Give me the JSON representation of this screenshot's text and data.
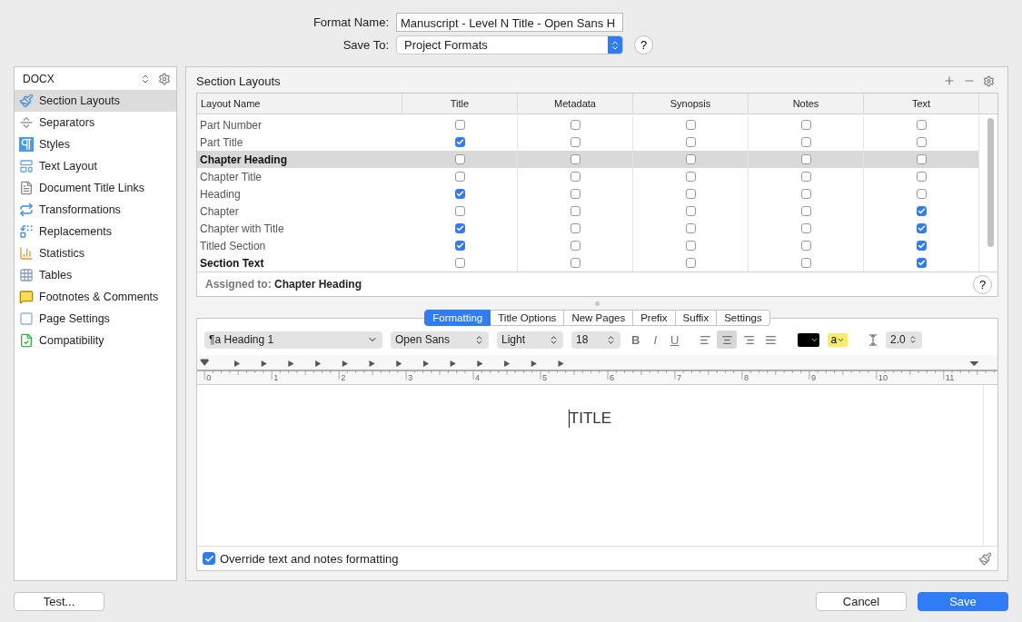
{
  "header": {
    "format_name_label": "Format Name:",
    "format_name_value": "Manuscript - Level N Title - Open Sans H",
    "save_to_label": "Save To:",
    "save_to_value": "Project Formats",
    "help": "?"
  },
  "sidebar": {
    "format": "DOCX",
    "items": [
      {
        "label": "Section Layouts",
        "selected": true
      },
      {
        "label": "Separators",
        "selected": false
      },
      {
        "label": "Styles",
        "selected": false
      },
      {
        "label": "Text Layout",
        "selected": false
      },
      {
        "label": "Document Title Links",
        "selected": false
      },
      {
        "label": "Transformations",
        "selected": false
      },
      {
        "label": "Replacements",
        "selected": false
      },
      {
        "label": "Statistics",
        "selected": false
      },
      {
        "label": "Tables",
        "selected": false
      },
      {
        "label": "Footnotes & Comments",
        "selected": false
      },
      {
        "label": "Page Settings",
        "selected": false
      },
      {
        "label": "Compatibility",
        "selected": false
      }
    ]
  },
  "section_layouts": {
    "title": "Section Layouts",
    "columns": [
      "Layout Name",
      "Title",
      "Metadata",
      "Synopsis",
      "Notes",
      "Text"
    ],
    "rows": [
      {
        "name": "Part Number",
        "bold": false,
        "selected": false,
        "checks": [
          false,
          false,
          false,
          false,
          false
        ]
      },
      {
        "name": "Part Title",
        "bold": false,
        "selected": false,
        "checks": [
          true,
          false,
          false,
          false,
          false
        ]
      },
      {
        "name": "Chapter Heading",
        "bold": true,
        "selected": true,
        "checks": [
          false,
          false,
          false,
          false,
          false
        ]
      },
      {
        "name": "Chapter Title",
        "bold": false,
        "selected": false,
        "checks": [
          false,
          false,
          false,
          false,
          false
        ]
      },
      {
        "name": "Heading",
        "bold": false,
        "selected": false,
        "checks": [
          true,
          false,
          false,
          false,
          false
        ]
      },
      {
        "name": "Chapter",
        "bold": false,
        "selected": false,
        "checks": [
          false,
          false,
          false,
          false,
          true
        ]
      },
      {
        "name": "Chapter with Title",
        "bold": false,
        "selected": false,
        "checks": [
          true,
          false,
          false,
          false,
          true
        ]
      },
      {
        "name": "Titled Section",
        "bold": false,
        "selected": false,
        "checks": [
          true,
          false,
          false,
          false,
          true
        ]
      },
      {
        "name": "Section Text",
        "bold": true,
        "selected": false,
        "checks": [
          false,
          false,
          false,
          false,
          true
        ]
      }
    ],
    "assigned_label": "Assigned to:",
    "assigned_value": "Chapter Heading",
    "help": "?"
  },
  "tabs": [
    {
      "label": "Formatting",
      "selected": true
    },
    {
      "label": "Title Options",
      "selected": false
    },
    {
      "label": "New Pages",
      "selected": false
    },
    {
      "label": "Prefix",
      "selected": false
    },
    {
      "label": "Suffix",
      "selected": false
    },
    {
      "label": "Settings",
      "selected": false
    }
  ],
  "toolbar": {
    "style_symbol": "¶a",
    "style": "Heading 1",
    "font": "Open Sans",
    "weight": "Light",
    "size": "18",
    "bold": "B",
    "italic": "I",
    "underline": "U",
    "alignments": [
      {
        "selected": false
      },
      {
        "selected": true
      },
      {
        "selected": false
      },
      {
        "selected": false
      }
    ],
    "highlight": "a",
    "line_spacing": "2.0"
  },
  "ruler": {
    "labels": [
      "0",
      "1",
      "2",
      "3",
      "4",
      "5",
      "6",
      "7",
      "8",
      "9",
      "10",
      "11"
    ]
  },
  "editor": {
    "text": "TITLE"
  },
  "override": {
    "label": "Override text and notes formatting",
    "checked": true
  },
  "buttons": {
    "test": "Test...",
    "cancel": "Cancel",
    "save": "Save"
  }
}
